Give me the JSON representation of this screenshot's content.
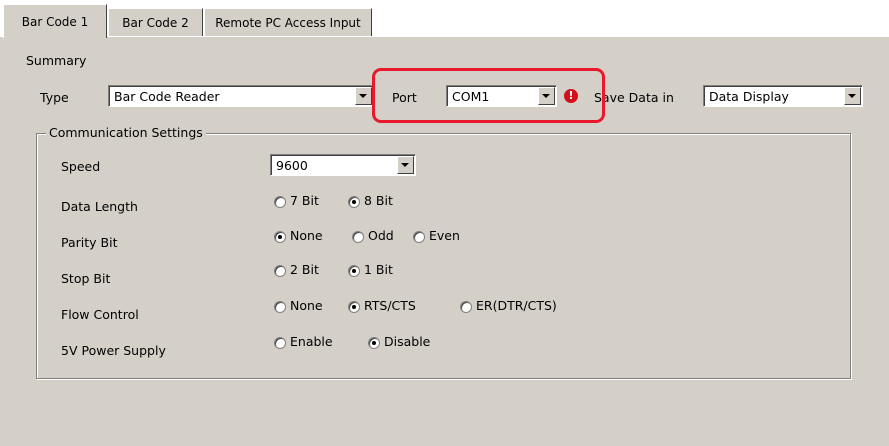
{
  "tabs": [
    {
      "label": "Bar Code 1",
      "active": true
    },
    {
      "label": "Bar Code 2",
      "active": false
    },
    {
      "label": "Remote PC Access Input",
      "active": false
    }
  ],
  "summary": {
    "title": "Summary",
    "type_label": "Type",
    "type_value": "Bar Code Reader",
    "port_label": "Port",
    "port_value": "COM1",
    "save_label": "Save Data in",
    "save_value": "Data Display",
    "warning_icon": "error-icon"
  },
  "comm": {
    "title": "Communication Settings",
    "speed_label": "Speed",
    "speed_value": "9600",
    "data_length_label": "Data Length",
    "data_length_options": [
      "7 Bit",
      "8 Bit"
    ],
    "data_length_selected": "8 Bit",
    "parity_label": "Parity Bit",
    "parity_options": [
      "None",
      "Odd",
      "Even"
    ],
    "parity_selected": "None",
    "stop_label": "Stop Bit",
    "stop_options": [
      "2 Bit",
      "1 Bit"
    ],
    "stop_selected": "1 Bit",
    "flow_label": "Flow Control",
    "flow_options": [
      "None",
      "RTS/CTS",
      "ER(DTR/CTS)"
    ],
    "flow_selected": "RTS/CTS",
    "power_label": "5V Power Supply",
    "power_options": [
      "Enable",
      "Disable"
    ],
    "power_selected": "Disable"
  },
  "colors": {
    "panel": "#d4d0c8",
    "highlight": "#e8192c",
    "warning": "#d0101b"
  }
}
